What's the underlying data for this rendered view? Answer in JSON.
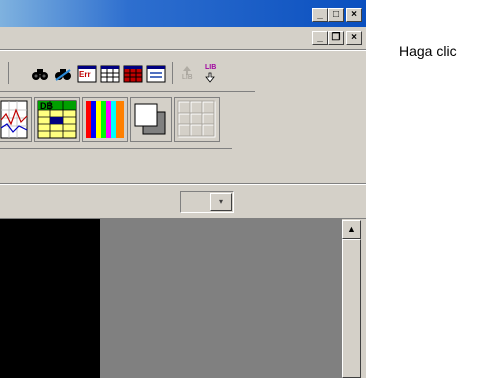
{
  "window": {
    "caption_buttons": {
      "minimize": "_",
      "maximize": "□",
      "close": "×"
    },
    "mdi_buttons": {
      "minimize": "_",
      "restore": "❐",
      "close": "×"
    }
  },
  "toolbar": {
    "err_label": "Err",
    "db_label": "DB",
    "lib_label": "LIB"
  },
  "combo": {
    "value": "",
    "arrow": "▾"
  },
  "scrollbar": {
    "up_arrow": "▲"
  },
  "right_panel": {
    "hint_text": "Haga clic"
  },
  "colors": {
    "title_gradient_end": "#0a4fbf",
    "dialog_face": "#d4d0c8",
    "workspace": "#808080",
    "black_panel": "#000000"
  }
}
